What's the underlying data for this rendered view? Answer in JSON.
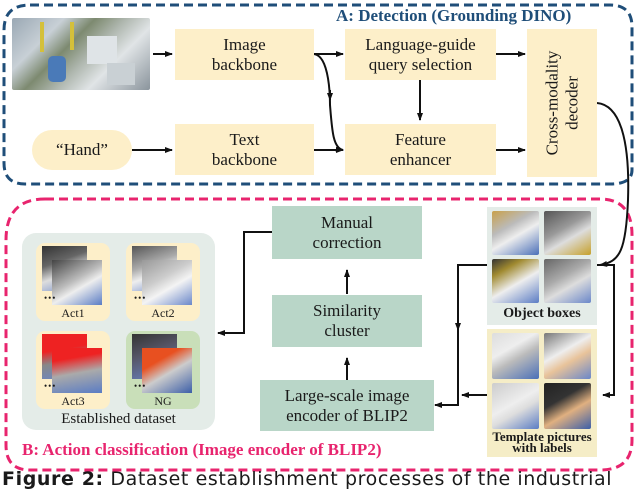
{
  "colors": {
    "detection_border": "#1f4e79",
    "classification_border": "#e8246e",
    "yellow_box": "#fdefc9",
    "green_box": "#b9d6c8",
    "dataset_panel": "#e4ece8",
    "ng_tile": "#c9dfb9"
  },
  "detection": {
    "title": "A: Detection (Grounding DINO)",
    "input_image_icon": "factory-scene-photo",
    "hand_prompt": "“Hand”",
    "image_backbone": [
      "Image",
      "backbone"
    ],
    "text_backbone": [
      "Text",
      "backbone"
    ],
    "query_selection": [
      "Language-guide",
      "query selection"
    ],
    "feature_enhancer": [
      "Feature",
      "enhancer"
    ],
    "decoder": [
      "Cross-modality",
      "decoder"
    ]
  },
  "classification": {
    "title": "B: Action classification (Image encoder of BLIP2)",
    "manual_correction": [
      "Manual",
      "correction"
    ],
    "similarity_cluster": [
      "Similarity",
      "cluster"
    ],
    "encoder": [
      "Large-scale image",
      "encoder of BLIP2"
    ],
    "object_boxes_label": "Object boxes",
    "template_label": [
      "Template pictures",
      "with labels"
    ],
    "dataset": {
      "label": "Established dataset",
      "tiles": [
        {
          "label": "Act1"
        },
        {
          "label": "Act2"
        },
        {
          "label": "Act3"
        },
        {
          "label": "NG"
        }
      ],
      "ellipsis": "•••"
    }
  },
  "caption": {
    "prefix": "Figure 2:",
    "text": " Dataset establishment processes of the industrial"
  }
}
